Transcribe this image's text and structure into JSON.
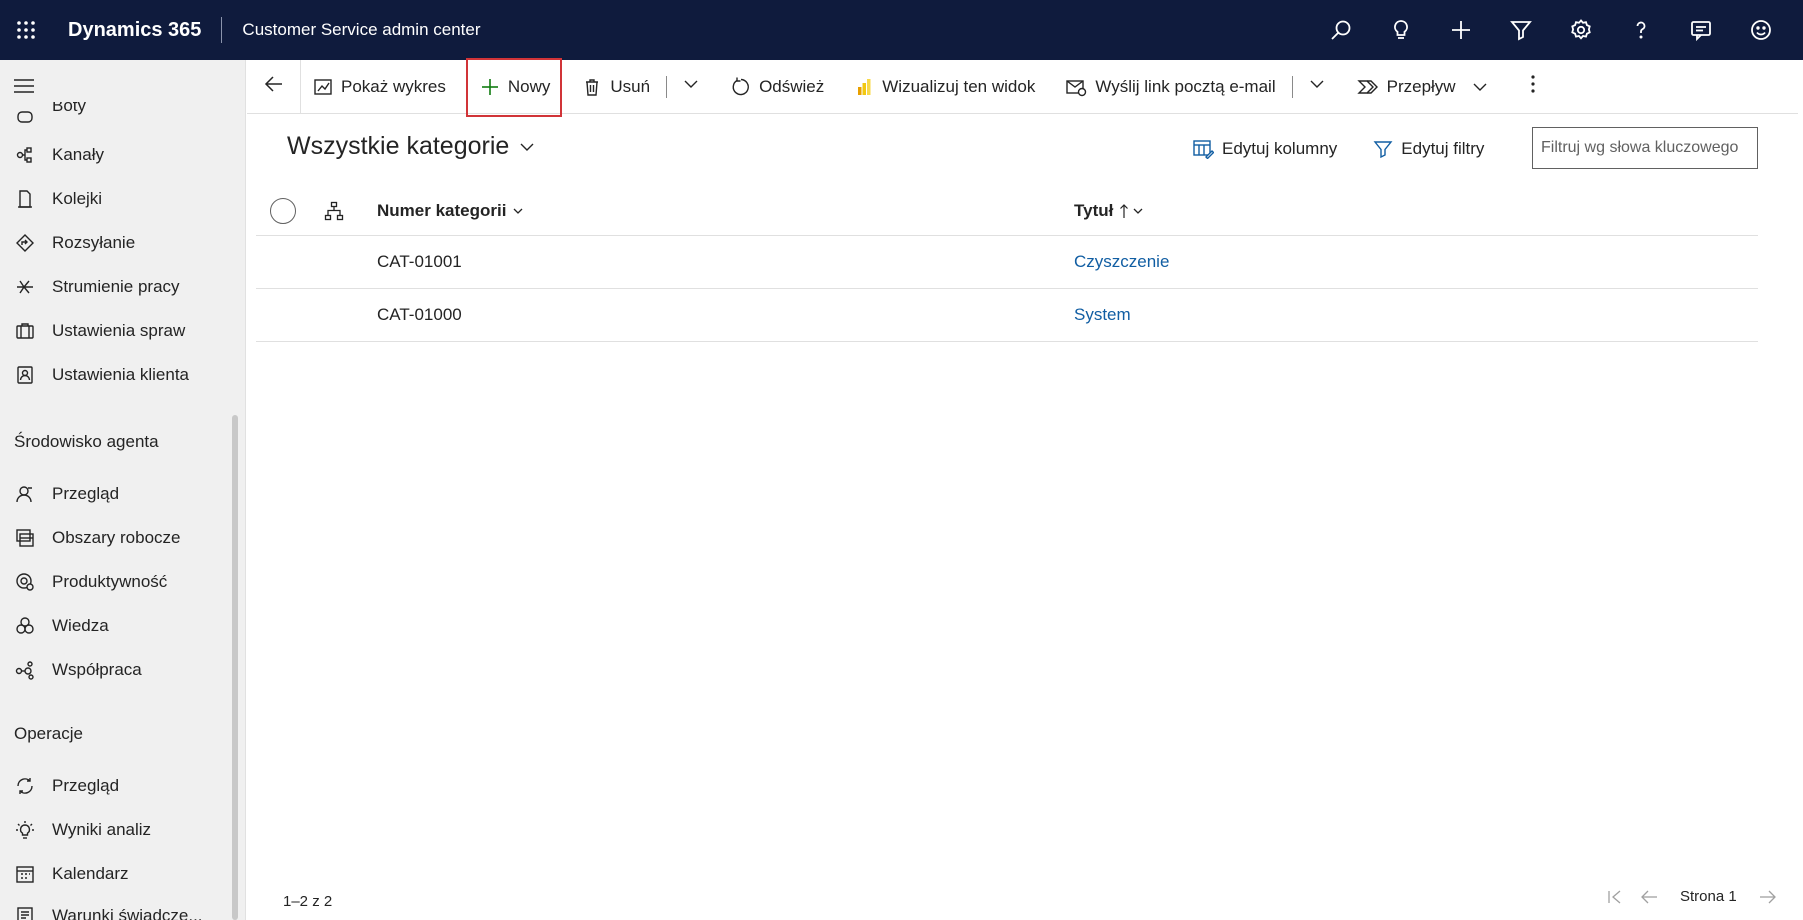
{
  "app": {
    "brand": "Dynamics 365",
    "title": "Customer Service admin center"
  },
  "topbar_icons": [
    "search-icon",
    "lightbulb-icon",
    "plus-icon",
    "filter-icon",
    "gear-icon",
    "help-icon",
    "chat-icon",
    "smiley-icon"
  ],
  "sidebar": {
    "partial_item": "Boty",
    "items_top": [
      {
        "label": "Kanały",
        "icon": "channels-icon"
      },
      {
        "label": "Kolejki",
        "icon": "queues-icon"
      },
      {
        "label": "Rozsyłanie",
        "icon": "routing-icon"
      },
      {
        "label": "Strumienie pracy",
        "icon": "workstreams-icon"
      },
      {
        "label": "Ustawienia spraw",
        "icon": "case-settings-icon"
      },
      {
        "label": "Ustawienia klienta",
        "icon": "customer-settings-icon"
      }
    ],
    "group_agent": "Środowisko agenta",
    "items_agent": [
      {
        "label": "Przegląd",
        "icon": "person-icon"
      },
      {
        "label": "Obszary robocze",
        "icon": "workspaces-icon"
      },
      {
        "label": "Produktywność",
        "icon": "productivity-icon"
      },
      {
        "label": "Wiedza",
        "icon": "knowledge-icon"
      },
      {
        "label": "Współpraca",
        "icon": "collaboration-icon"
      }
    ],
    "group_ops": "Operacje",
    "items_ops": [
      {
        "label": "Przegląd",
        "icon": "overview-icon"
      },
      {
        "label": "Wyniki analiz",
        "icon": "insights-icon"
      },
      {
        "label": "Kalendarz",
        "icon": "calendar-icon"
      },
      {
        "label": "Warunki świadcze...",
        "icon": "terms-icon"
      }
    ]
  },
  "commands": {
    "show_chart": "Pokaż wykres",
    "new": "Nowy",
    "delete": "Usuń",
    "refresh": "Odśwież",
    "visualize": "Wizualizuj ten widok",
    "email_link": "Wyślij link pocztą e-mail",
    "flow": "Przepływ"
  },
  "view": {
    "title": "Wszystkie kategorie",
    "edit_columns": "Edytuj kolumny",
    "edit_filters": "Edytuj filtry",
    "filter_placeholder": "Filtruj wg słowa kluczowego"
  },
  "grid": {
    "columns": [
      "Numer kategorii",
      "Tytuł"
    ],
    "rows": [
      {
        "number": "CAT-01001",
        "title": "Czyszczenie"
      },
      {
        "number": "CAT-01000",
        "title": "System"
      }
    ]
  },
  "footer": {
    "count": "1–2 z 2",
    "page": "Strona 1"
  },
  "colors": {
    "topbar": "#0f1b3d",
    "link": "#115ea3",
    "highlight": "#d13438",
    "new_plus": "#107c10"
  }
}
